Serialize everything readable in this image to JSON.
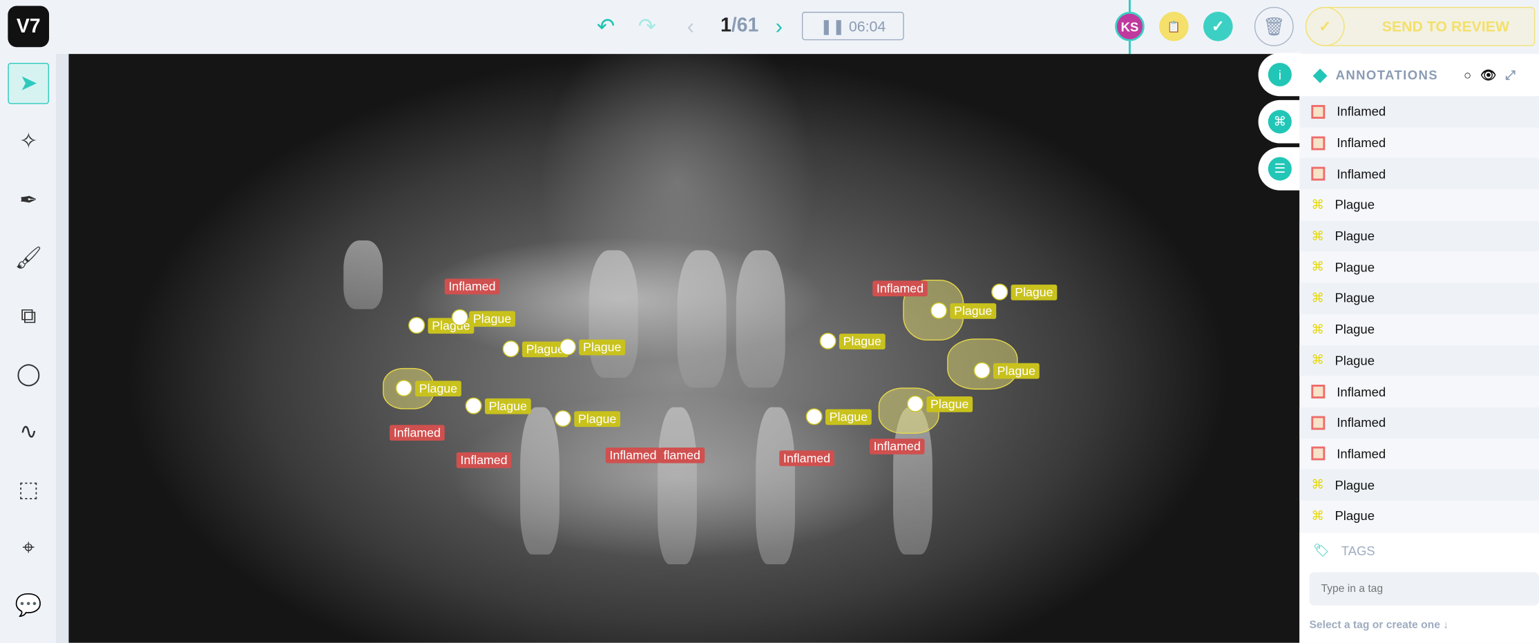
{
  "app": {
    "logo": "V7"
  },
  "toolbar": {
    "undo_icon": "↶",
    "redo_icon": "↷",
    "prev_icon": "‹",
    "next_icon": "›",
    "page_current": "1",
    "page_total": "/61",
    "timer": "❚❚ 06:04"
  },
  "workflow": {
    "assignee_initials": "KS",
    "review_icon": "📋",
    "complete_icon": "✓",
    "colors": {
      "assignee": "#c0399e",
      "review": "#f4e06a",
      "complete": "#3cd0c4"
    }
  },
  "actions": {
    "delete_icon": "🗑",
    "send_to_review": "SEND TO REVIEW"
  },
  "tools": [
    "select",
    "auto-annotate",
    "pen",
    "brush",
    "polygon",
    "ellipse",
    "line",
    "cuboid",
    "keypoint",
    "comment"
  ],
  "canvas": {
    "overlays": [
      {
        "label": "Inflamed"
      },
      {
        "label": "Inflamed"
      },
      {
        "label": "Inflamed"
      },
      {
        "label": "Inflamed"
      },
      {
        "label": "Inflamed"
      },
      {
        "label": "flamed"
      },
      {
        "label": "Inflamed"
      },
      {
        "label": "Inflamed"
      },
      {
        "label": "Plague"
      },
      {
        "label": "Plague"
      },
      {
        "label": "Plague"
      },
      {
        "label": "Plague"
      },
      {
        "label": "Plague"
      },
      {
        "label": "Plague"
      },
      {
        "label": "Plague"
      },
      {
        "label": "Plague"
      },
      {
        "label": "Plague"
      },
      {
        "label": "Plague"
      },
      {
        "label": "Plague"
      },
      {
        "label": "Plague"
      },
      {
        "label": "Plague"
      }
    ]
  },
  "side_buttons": {
    "info": "i",
    "shortcuts": "⌘",
    "settings": "☰"
  },
  "annotations": {
    "title": "ANNOTATIONS",
    "items": [
      {
        "label": "Inflamed",
        "type": "bounding-box"
      },
      {
        "label": "Inflamed",
        "type": "bounding-box"
      },
      {
        "label": "Inflamed",
        "type": "bounding-box"
      },
      {
        "label": "Plague",
        "type": "polygon"
      },
      {
        "label": "Plague",
        "type": "polygon"
      },
      {
        "label": "Plague",
        "type": "polygon"
      },
      {
        "label": "Plague",
        "type": "polygon"
      },
      {
        "label": "Plague",
        "type": "polygon"
      },
      {
        "label": "Plague",
        "type": "polygon"
      },
      {
        "label": "Inflamed",
        "type": "bounding-box"
      },
      {
        "label": "Inflamed",
        "type": "bounding-box"
      },
      {
        "label": "Inflamed",
        "type": "bounding-box"
      },
      {
        "label": "Plague",
        "type": "polygon"
      },
      {
        "label": "Plague",
        "type": "polygon"
      }
    ]
  },
  "tags": {
    "title": "TAGS",
    "placeholder": "Type in a tag",
    "hint": "Select a tag or create one ↓"
  }
}
